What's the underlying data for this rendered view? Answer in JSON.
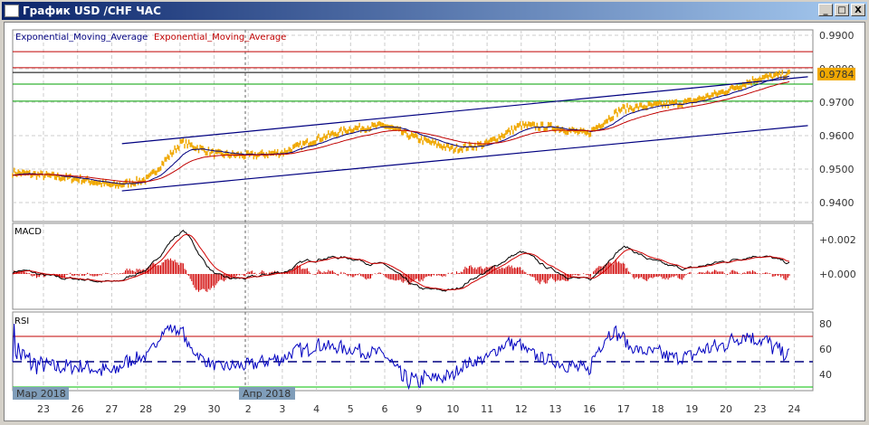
{
  "window": {
    "title": "График USD /CHF ЧАС",
    "min": "_",
    "max": "□",
    "close": "X"
  },
  "legend": {
    "ema1": "Exponential_Moving_Average",
    "ema2": "Exponential_Moving_Average",
    "ema1_color": "#000080",
    "ema2_color": "#c00000"
  },
  "price_axis": [
    "0.9900",
    "0.9800",
    "0.9700",
    "0.9600",
    "0.9500",
    "0.9400"
  ],
  "current_price": "0.9784",
  "macd": {
    "label": "MACD",
    "ticks": [
      "+0.002",
      "+0.000"
    ]
  },
  "rsi": {
    "label": "RSI",
    "ticks": [
      "80",
      "60",
      "40"
    ]
  },
  "months": [
    "Мар 2018",
    "Апр 2018"
  ],
  "dates": [
    "23",
    "26",
    "27",
    "28",
    "29",
    "30",
    "2",
    "3",
    "4",
    "5",
    "6",
    "9",
    "10",
    "11",
    "12",
    "13",
    "16",
    "17",
    "18",
    "19",
    "20",
    "23",
    "24"
  ],
  "chart_data": {
    "type": "line",
    "title": "USD/CHF hourly",
    "price_close_by_day": [
      0.948,
      0.947,
      0.945,
      0.947,
      0.958,
      0.9545,
      0.954,
      0.955,
      0.959,
      0.962,
      0.963,
      0.959,
      0.956,
      0.9575,
      0.963,
      0.9625,
      0.9605,
      0.968,
      0.969,
      0.97,
      0.973,
      0.977,
      0.9784
    ],
    "price_ylim": [
      0.936,
      0.992
    ],
    "hlines": [
      {
        "value": 0.9851,
        "color": "#c00000"
      },
      {
        "value": 0.9803,
        "color": "#c00000"
      },
      {
        "value": 0.9789,
        "color": "#000000"
      },
      {
        "value": 0.9754,
        "color": "#00a000"
      },
      {
        "value": 0.9703,
        "color": "#00a000"
      }
    ],
    "channel": [
      {
        "from": [
          2.3,
          0.9576
        ],
        "to": [
          22.4,
          0.9776
        ]
      },
      {
        "from": [
          2.3,
          0.9435
        ],
        "to": [
          22.4,
          0.963
        ]
      }
    ],
    "macd_ylim": [
      -0.001,
      0.003
    ],
    "rsi_levels": [
      70,
      50,
      30
    ],
    "rsi_ylim": [
      28,
      86
    ]
  }
}
